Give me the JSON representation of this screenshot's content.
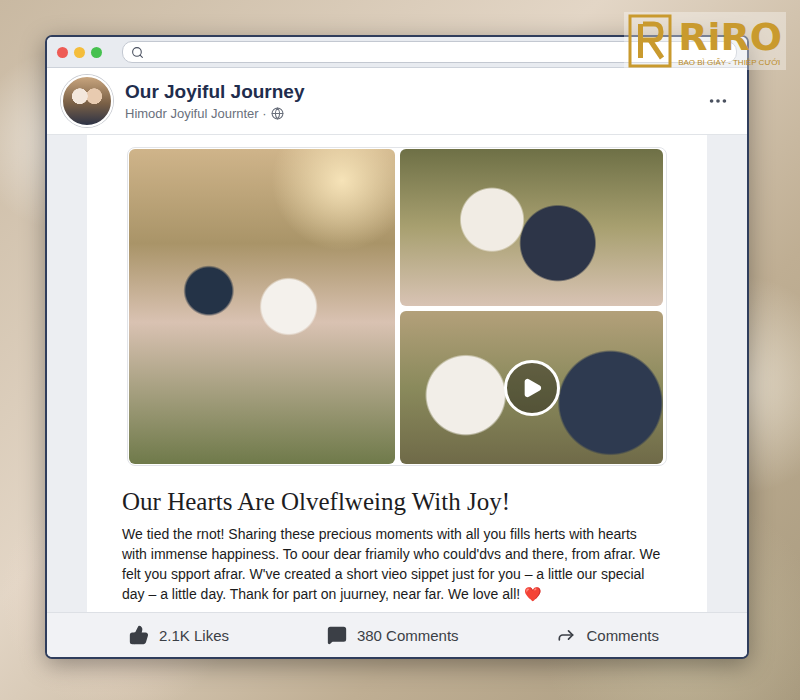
{
  "logo": {
    "name": "RiRO",
    "tagline": "BAO BÌ GIẤY - THIỆP CƯỚI"
  },
  "post": {
    "page_name": "Our Joyiful Journey",
    "subtitle": "Himodr Joyiful Journter ·"
  },
  "media": [
    {
      "kind": "photo"
    },
    {
      "kind": "photo"
    },
    {
      "kind": "video"
    }
  ],
  "heading": "Our Hearts Are Olveflweing With Joy!",
  "body": "We tied the rnot! Sharing these precious moments with all you fills herts with hearts with immense happiness. To oour dear friamily who could'dvs and there, from afrar. We felt you spport afrar. W've created a short vieo sippet just for you – a little our special day – a little day. Thank for part on juurney, near far. We love all! ❤️",
  "actions": [
    {
      "kind": "like",
      "label": "2.1K Likes"
    },
    {
      "kind": "comment",
      "label": "380 Comments"
    },
    {
      "kind": "share",
      "label": "Comments"
    }
  ]
}
